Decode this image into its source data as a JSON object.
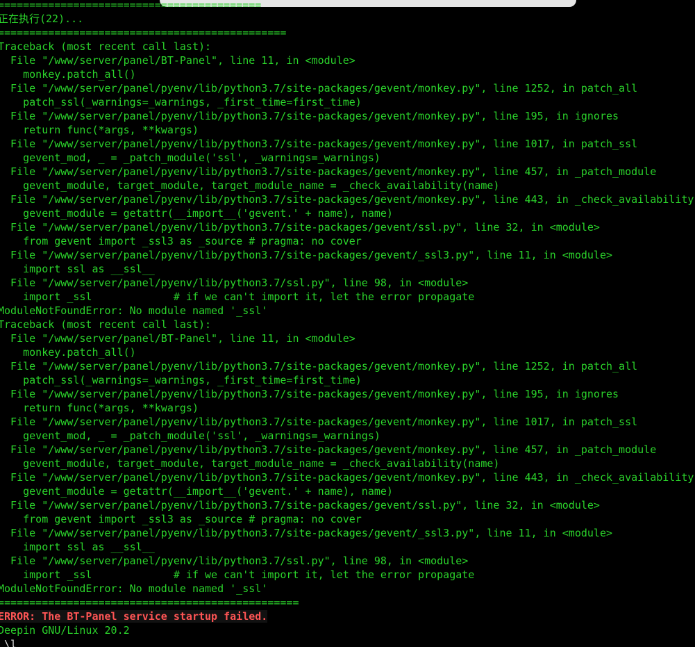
{
  "terminal": {
    "lines": [
      {
        "text": "==========================================",
        "kind": "normal"
      },
      {
        "text": "正在执行(22)...",
        "kind": "normal"
      },
      {
        "text": "==============================================",
        "kind": "normal"
      },
      {
        "text": "Traceback (most recent call last):",
        "kind": "normal"
      },
      {
        "text": "  File \"/www/server/panel/BT-Panel\", line 11, in <module>",
        "kind": "normal"
      },
      {
        "text": "    monkey.patch_all()",
        "kind": "normal"
      },
      {
        "text": "  File \"/www/server/panel/pyenv/lib/python3.7/site-packages/gevent/monkey.py\", line 1252, in patch_all",
        "kind": "normal"
      },
      {
        "text": "    patch_ssl(_warnings=_warnings, _first_time=first_time)",
        "kind": "normal"
      },
      {
        "text": "  File \"/www/server/panel/pyenv/lib/python3.7/site-packages/gevent/monkey.py\", line 195, in ignores",
        "kind": "normal"
      },
      {
        "text": "    return func(*args, **kwargs)",
        "kind": "normal"
      },
      {
        "text": "  File \"/www/server/panel/pyenv/lib/python3.7/site-packages/gevent/monkey.py\", line 1017, in patch_ssl",
        "kind": "normal"
      },
      {
        "text": "    gevent_mod, _ = _patch_module('ssl', _warnings=_warnings)",
        "kind": "normal"
      },
      {
        "text": "  File \"/www/server/panel/pyenv/lib/python3.7/site-packages/gevent/monkey.py\", line 457, in _patch_module",
        "kind": "normal"
      },
      {
        "text": "    gevent_module, target_module, target_module_name = _check_availability(name)",
        "kind": "normal"
      },
      {
        "text": "  File \"/www/server/panel/pyenv/lib/python3.7/site-packages/gevent/monkey.py\", line 443, in _check_availability",
        "kind": "normal"
      },
      {
        "text": "    gevent_module = getattr(__import__('gevent.' + name), name)",
        "kind": "normal"
      },
      {
        "text": "  File \"/www/server/panel/pyenv/lib/python3.7/site-packages/gevent/ssl.py\", line 32, in <module>",
        "kind": "normal"
      },
      {
        "text": "    from gevent import _ssl3 as _source # pragma: no cover",
        "kind": "normal"
      },
      {
        "text": "  File \"/www/server/panel/pyenv/lib/python3.7/site-packages/gevent/_ssl3.py\", line 11, in <module>",
        "kind": "normal"
      },
      {
        "text": "    import ssl as __ssl__",
        "kind": "normal"
      },
      {
        "text": "  File \"/www/server/panel/pyenv/lib/python3.7/ssl.py\", line 98, in <module>",
        "kind": "normal"
      },
      {
        "text": "    import _ssl             # if we can't import it, let the error propagate",
        "kind": "normal"
      },
      {
        "text": "ModuleNotFoundError: No module named '_ssl'",
        "kind": "normal"
      },
      {
        "text": "Traceback (most recent call last):",
        "kind": "normal"
      },
      {
        "text": "  File \"/www/server/panel/BT-Panel\", line 11, in <module>",
        "kind": "normal"
      },
      {
        "text": "    monkey.patch_all()",
        "kind": "normal"
      },
      {
        "text": "  File \"/www/server/panel/pyenv/lib/python3.7/site-packages/gevent/monkey.py\", line 1252, in patch_all",
        "kind": "normal"
      },
      {
        "text": "    patch_ssl(_warnings=_warnings, _first_time=first_time)",
        "kind": "normal"
      },
      {
        "text": "  File \"/www/server/panel/pyenv/lib/python3.7/site-packages/gevent/monkey.py\", line 195, in ignores",
        "kind": "normal"
      },
      {
        "text": "    return func(*args, **kwargs)",
        "kind": "normal"
      },
      {
        "text": "  File \"/www/server/panel/pyenv/lib/python3.7/site-packages/gevent/monkey.py\", line 1017, in patch_ssl",
        "kind": "normal"
      },
      {
        "text": "    gevent_mod, _ = _patch_module('ssl', _warnings=_warnings)",
        "kind": "normal"
      },
      {
        "text": "  File \"/www/server/panel/pyenv/lib/python3.7/site-packages/gevent/monkey.py\", line 457, in _patch_module",
        "kind": "normal"
      },
      {
        "text": "    gevent_module, target_module, target_module_name = _check_availability(name)",
        "kind": "normal"
      },
      {
        "text": "  File \"/www/server/panel/pyenv/lib/python3.7/site-packages/gevent/monkey.py\", line 443, in _check_availability",
        "kind": "normal"
      },
      {
        "text": "    gevent_module = getattr(__import__('gevent.' + name), name)",
        "kind": "normal"
      },
      {
        "text": "  File \"/www/server/panel/pyenv/lib/python3.7/site-packages/gevent/ssl.py\", line 32, in <module>",
        "kind": "normal"
      },
      {
        "text": "    from gevent import _ssl3 as _source # pragma: no cover",
        "kind": "normal"
      },
      {
        "text": "  File \"/www/server/panel/pyenv/lib/python3.7/site-packages/gevent/_ssl3.py\", line 11, in <module>",
        "kind": "normal"
      },
      {
        "text": "    import ssl as __ssl__",
        "kind": "normal"
      },
      {
        "text": "  File \"/www/server/panel/pyenv/lib/python3.7/ssl.py\", line 98, in <module>",
        "kind": "normal"
      },
      {
        "text": "    import _ssl             # if we can't import it, let the error propagate",
        "kind": "normal"
      },
      {
        "text": "ModuleNotFoundError: No module named '_ssl'",
        "kind": "normal"
      },
      {
        "text": "================================================",
        "kind": "normal"
      },
      {
        "text": "ERROR: The BT-Panel service startup failed.",
        "kind": "error"
      },
      {
        "text": "Deepin GNU/Linux 20.2",
        "kind": "normal"
      },
      {
        "text": " \\l",
        "kind": "white"
      }
    ]
  },
  "colors": {
    "background": "#000000",
    "text": "#2bd42b",
    "error_text": "#ff5555",
    "error_background": "#111111"
  }
}
